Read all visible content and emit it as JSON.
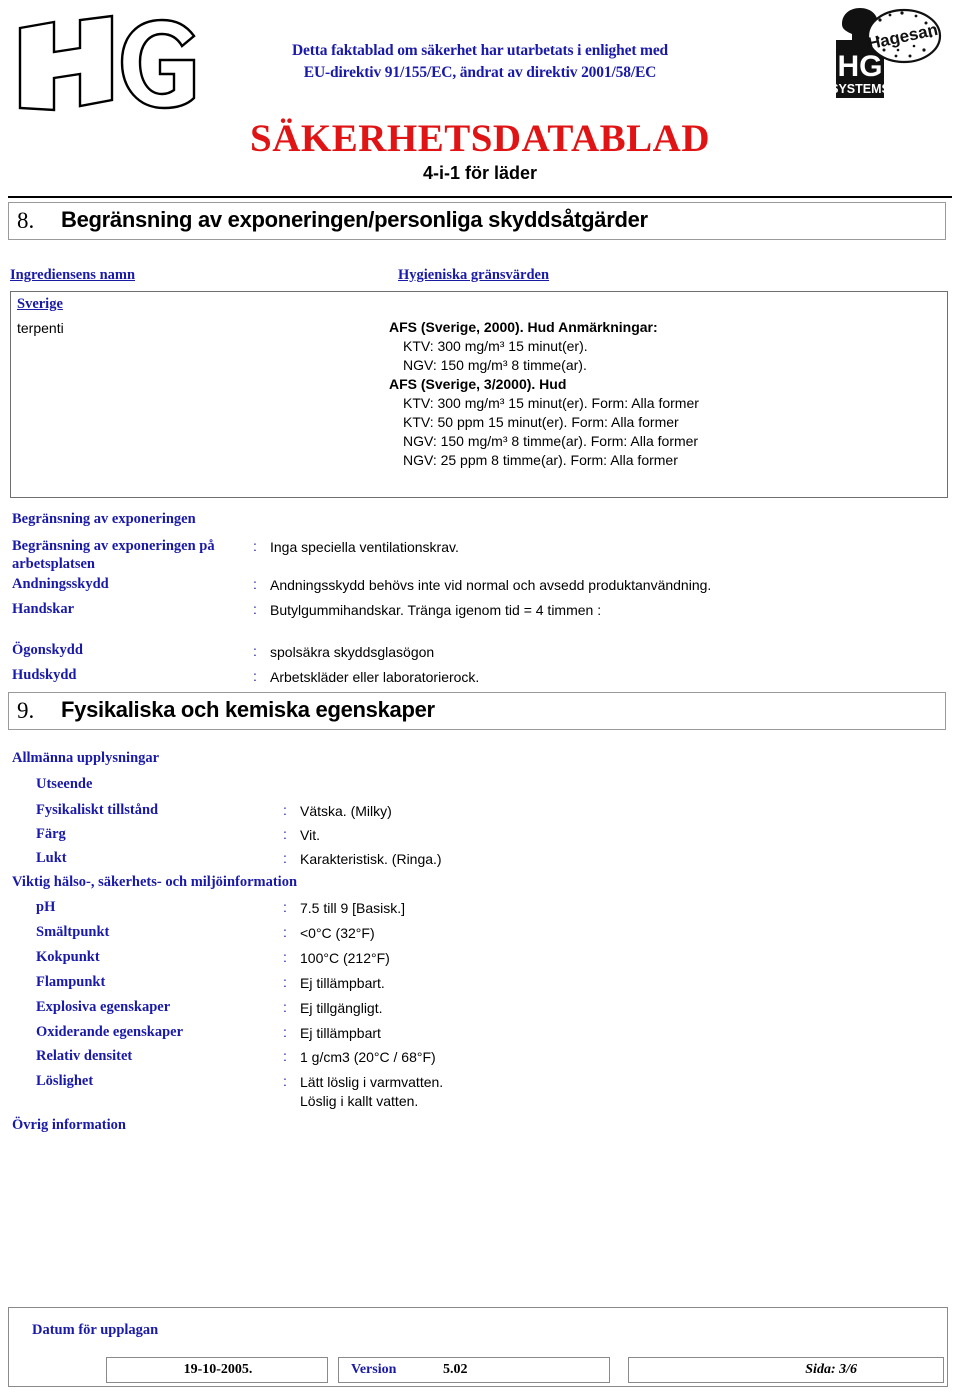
{
  "header": {
    "logo_left_text": "HG",
    "eu_statement_line1": "Detta faktablad om säkerhet har utarbetats i enlighet med",
    "eu_statement_line2": "EU-direktiv 91/155/EC, ändrat av direktiv 2001/58/EC",
    "document_title": "SÄKERHETSDATABLAD",
    "product_name": "4-i-1 för läder",
    "brand_logo_main": "HG",
    "brand_logo_sub": "SYSTEMS",
    "brand_logo_badge": "Hagesan",
    "title_color": "#e01414",
    "accent_color": "#1a1aa8"
  },
  "section8": {
    "number": "8.",
    "title": "Begränsning av exponeringen/personliga skyddsåtgärder",
    "table": {
      "headers": [
        "Ingrediensens namn",
        "Hygieniska gränsvärden"
      ],
      "country": "Sverige",
      "ingredient": "terpenti",
      "limit_groups": [
        {
          "title": "AFS (Sverige, 2000).  Hud Anmärkningar:",
          "lines": [
            "KTV: 300 mg/m³  15 minut(er).",
            "NGV: 150 mg/m³  8 timme(ar)."
          ]
        },
        {
          "title": "AFS (Sverige, 3/2000).  Hud",
          "lines": [
            "KTV: 300 mg/m³  15 minut(er). Form: Alla former",
            "KTV: 50 ppm  15 minut(er). Form: Alla former",
            "NGV: 150 mg/m³  8 timme(ar). Form: Alla former",
            "NGV: 25 ppm  8 timme(ar). Form: Alla former"
          ]
        }
      ]
    },
    "exposure_heading": "Begränsning av exponeringen",
    "colon": ":",
    "rows": [
      {
        "label": "Begränsning av exponeringen\npå arbetsplatsen",
        "value": "Inga speciella ventilationskrav."
      },
      {
        "label": "Andningsskydd",
        "value": "Andningsskydd behövs inte vid normal och avsedd produktanvändning."
      },
      {
        "label": "Handskar",
        "value": "Butylgummihandskar. Tränga igenom tid = 4 timmen :"
      },
      {
        "label": "Ögonskydd",
        "value": "spolsäkra skyddsglasögon"
      },
      {
        "label": "Hudskydd",
        "value": "Arbetskläder eller laboratorierock."
      }
    ]
  },
  "section9": {
    "number": "9.",
    "title": "Fysikaliska och kemiska egenskaper",
    "general_heading": "Allmänna upplysningar",
    "appearance_heading": "Utseende",
    "colon": ":",
    "appearance_rows": [
      {
        "label": "Fysikaliskt tillstånd",
        "value": "Vätska. (Milky)"
      },
      {
        "label": "Färg",
        "value": "Vit."
      },
      {
        "label": "Lukt",
        "value": "Karakteristisk. (Ringa.)"
      }
    ],
    "important_heading": "Viktig hälso-, säkerhets- och miljöinformation",
    "property_rows": [
      {
        "label": "pH",
        "value": "7.5 till 9 [Basisk.]"
      },
      {
        "label": "Smältpunkt",
        "value": "<0°C (32°F)"
      },
      {
        "label": "Kokpunkt",
        "value": "100°C (212°F)"
      },
      {
        "label": "Flampunkt",
        "value": "Ej tillämpbart."
      },
      {
        "label": "Explosiva egenskaper",
        "value": "Ej tillgängligt."
      },
      {
        "label": "Oxiderande egenskaper",
        "value": "Ej tillämpbart"
      },
      {
        "label": "Relativ densitet",
        "value": "1 g/cm3  (20°C / 68°F)"
      },
      {
        "label": "Löslighet",
        "value": "Lätt löslig i varmvatten.\nLöslig i kallt vatten."
      }
    ],
    "other_heading": "Övrig information"
  },
  "footer": {
    "date_label": "Datum för\nupplagan",
    "date_value": "19-10-2005.",
    "version_label": "Version",
    "version_value": "5.02",
    "page_value": "Sida: 3/6"
  }
}
